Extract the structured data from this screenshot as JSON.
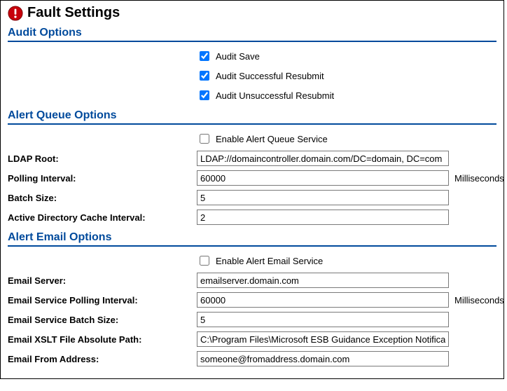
{
  "header": {
    "title": "Fault Settings",
    "icon_name": "alert-icon"
  },
  "audit": {
    "title": "Audit Options",
    "save": {
      "label": "Audit Save",
      "checked": true
    },
    "success": {
      "label": "Audit Successful Resubmit",
      "checked": true
    },
    "unsuccess": {
      "label": "Audit Unsuccessful Resubmit",
      "checked": true
    }
  },
  "queue": {
    "title": "Alert Queue Options",
    "enable": {
      "label": "Enable Alert Queue Service",
      "checked": false
    },
    "ldap": {
      "label": "LDAP Root:",
      "value": "LDAP://domaincontroller.domain.com/DC=domain, DC=com"
    },
    "polling": {
      "label": "Polling Interval:",
      "value": "60000",
      "units": "Milliseconds"
    },
    "batch": {
      "label": "Batch Size:",
      "value": "5"
    },
    "adcache": {
      "label": "Active Directory Cache Interval:",
      "value": "2"
    }
  },
  "email": {
    "title": "Alert Email Options",
    "enable": {
      "label": "Enable Alert Email Service",
      "checked": false
    },
    "server": {
      "label": "Email Server:",
      "value": "emailserver.domain.com"
    },
    "polling": {
      "label": "Email Service Polling Interval:",
      "value": "60000",
      "units": "Milliseconds"
    },
    "batch": {
      "label": "Email Service Batch Size:",
      "value": "5"
    },
    "xslt": {
      "label": "Email XSLT File Absolute Path:",
      "value": "C:\\Program Files\\Microsoft ESB Guidance Exception Notification"
    },
    "from": {
      "label": "Email From Address:",
      "value": "someone@fromaddress.domain.com"
    }
  }
}
